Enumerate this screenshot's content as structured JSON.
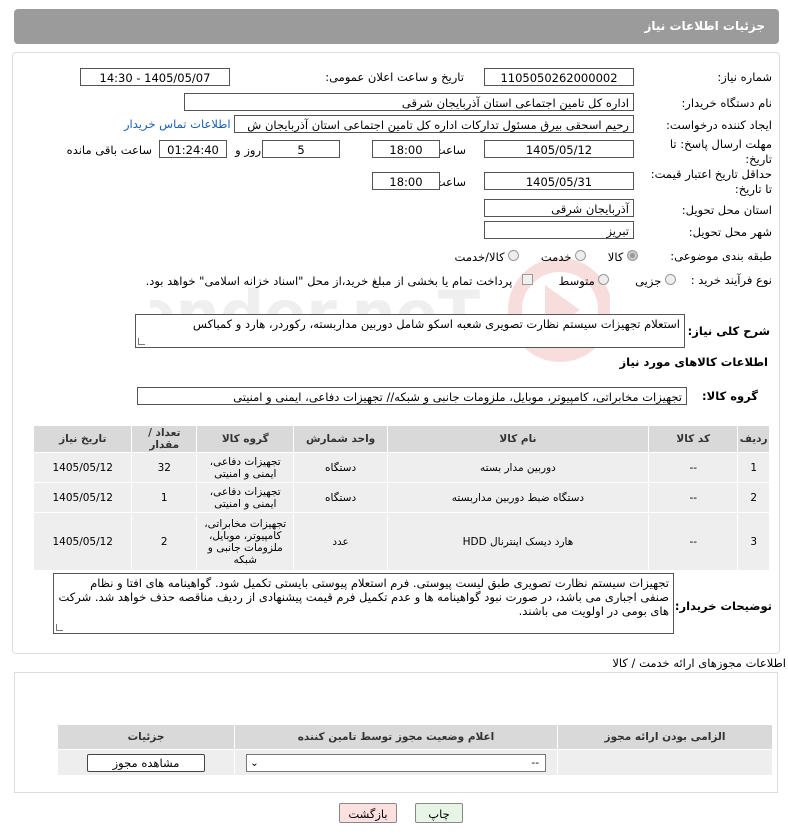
{
  "header": {
    "title": "جزئیات اطلاعات نیاز"
  },
  "form": {
    "need_number_label": "شماره نیاز:",
    "need_number": "1105050262000002",
    "announce_label": "تاریخ و ساعت اعلان عمومی:",
    "announce_value": "1405/05/07 - 14:30",
    "buyer_org_label": "نام دستگاه خریدار:",
    "buyer_org": "اداره کل تامین اجتماعی استان آذربایجان شرقی",
    "creator_label": "ایجاد کننده درخواست:",
    "creator": "رحیم اسحقی بیرق مسئول تدارکات اداره کل تامین اجتماعی استان آذربایجان ش",
    "contact_link": "اطلاعات تماس خریدار",
    "reply_deadline_label": "مهلت ارسال پاسخ: تا تاریخ:",
    "reply_date": "1405/05/12",
    "time_label": "ساعت",
    "reply_time": "18:00",
    "days": "5",
    "days_label": "روز و",
    "remaining_time": "01:24:40",
    "remaining_label": "ساعت باقی مانده",
    "price_deadline_label": "حداقل تاریخ اعتبار قیمت: تا تاریخ:",
    "price_date": "1405/05/31",
    "price_time": "18:00",
    "province_label": "استان محل تحویل:",
    "province": "آذربایجان شرقی",
    "city_label": "شهر محل تحویل:",
    "city": "تبریز",
    "category_label": "طبقه بندی موضوعی:",
    "category_options": [
      "کالا",
      "خدمت",
      "کالا/خدمت"
    ],
    "process_label": "نوع فرآیند خرید :",
    "process_options": [
      "جزیی",
      "متوسط"
    ],
    "payment_note": "پرداخت تمام یا بخشی از مبلغ خرید،از محل \"اسناد خزانه اسلامی\" خواهد بود."
  },
  "description": {
    "label": "شرح کلی نیاز:",
    "text": "استعلام تجهیزات سیستم نظارت تصویری شعبه اسکو شامل دوربین مداربسته، رکوردر، هارد و کمباکس"
  },
  "goods": {
    "section_title": "اطلاعات کالاهای مورد نیاز",
    "group_label": "گروه کالا:",
    "group_value": "تجهیزات مخابراتی، کامپیوتر، موبایل، ملزومات جانبی و شبکه// تجهیزات دفاعی، ایمنی و امنیتی",
    "columns": [
      "ردیف",
      "کد کالا",
      "نام کالا",
      "واحد شمارش",
      "گروه کالا",
      "تعداد / مقدار",
      "تاریخ نیاز"
    ],
    "rows": [
      {
        "idx": "1",
        "code": "--",
        "name": "دوربین مدار بسته",
        "unit": "دستگاه",
        "group": "تجهیزات دفاعی، ایمنی و امنیتی",
        "qty": "32",
        "date": "1405/05/12"
      },
      {
        "idx": "2",
        "code": "--",
        "name": "دستگاه ضبط دوربین مداربسته",
        "unit": "دستگاه",
        "group": "تجهیزات دفاعی، ایمنی و امنیتی",
        "qty": "1",
        "date": "1405/05/12"
      },
      {
        "idx": "3",
        "code": "--",
        "name": "هارد دیسک اینترنال HDD",
        "unit": "عدد",
        "group": "تجهیزات مخابراتی، کامپیوتر، موبایل، ملزومات جانبی و شبکه",
        "qty": "2",
        "date": "1405/05/12"
      }
    ]
  },
  "buyer_notes": {
    "label": "توضیحات خریدار:",
    "text": "تجهیزات سیستم نظارت تصویری طبق لیست پیوستی. فرم استعلام پیوستی بایستی تکمیل شود. گواهینامه های افتا و نظام صنفی اجباری می باشد، در صورت نبود گواهینامه ها و عدم تکمیل فرم قیمت پیشنهادی از ردیف مناقصه حذف خواهد شد. شرکت های بومی در اولویت می باشند."
  },
  "permits": {
    "section_title": "اطلاعات مجوزهای ارائه خدمت / کالا",
    "columns": [
      "الزامی بودن ارائه مجوز",
      "اعلام وضعیت مجوز توسط تامین کننده",
      "جزئیات"
    ],
    "select_value": "--",
    "view_button": "مشاهده مجوز"
  },
  "actions": {
    "print": "چاپ",
    "back": "بازگشت"
  },
  "watermark": "AriaTender.neT",
  "colors": {
    "header_bg": "#9b9b9b",
    "table_header": "#d9d9d9",
    "table_cell": "#eeeeee",
    "link": "#1a5fb4",
    "back_btn_bg": "#fde0e0",
    "print_btn_bg": "#e6f5e6"
  }
}
